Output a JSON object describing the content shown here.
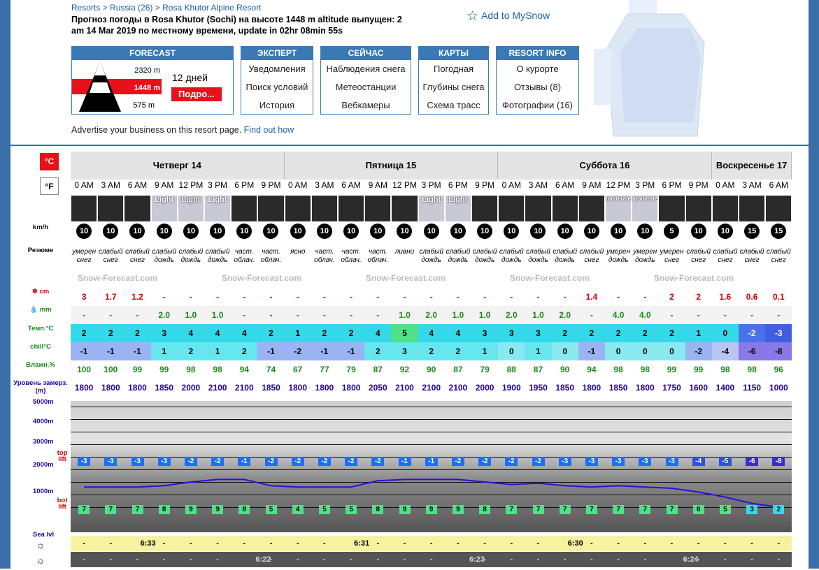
{
  "breadcrumb": {
    "resorts": "Resorts",
    "sep1": ">",
    "country": "Russia (26)",
    "sep2": ">",
    "resort": "Rosa Khutor Alpine Resort"
  },
  "headline": "Прогноз погоды в Rosa Khutor (Sochi) на высоте 1448 m altitude выпущен: 2 am  14 Mar 2019 по местному времени, update in 02hr 08min 55s",
  "mysnow": "Add to MySnow",
  "forecast_box": {
    "header": "FORECAST",
    "top": "2320 m",
    "mid": "1448 m",
    "bot": "575 m",
    "days": "12 дней",
    "button": "Подро..."
  },
  "menus": [
    {
      "header": "ЭКСПЕРТ",
      "items": [
        "Уведомления",
        "Поиск условий",
        "История"
      ]
    },
    {
      "header": "СЕЙЧАС",
      "items": [
        "Наблюдения снега",
        "Метеостанции",
        "Вебкамеры"
      ]
    },
    {
      "header": "КАРТЫ",
      "items": [
        "Погодная",
        "Глубины снега",
        "Схема трасс"
      ]
    },
    {
      "header": "RESORT INFO",
      "items": [
        "О курорте",
        "Отзывы (8)",
        "Фотографии (16)"
      ]
    }
  ],
  "advert": {
    "text": "Advertise your business on this resort page.",
    "link": "Find out how"
  },
  "units": {
    "c": "°C",
    "f": "°F"
  },
  "labels": {
    "wind": "km/h",
    "summary": "Резюме",
    "snow": "cm",
    "rain": "mm",
    "temp": "Темп.°C",
    "chill": "chill°C",
    "humid": "Влажн.%",
    "freeze": "Уровень замерз. (m)",
    "y5000": "5000m",
    "y4000": "4000m",
    "y3000": "3000m",
    "y2000": "2000m",
    "y1000": "1000m",
    "toplift": "top lift",
    "botlift": "bot lift",
    "sealvl": "Sea lvl"
  },
  "watermark": "Snow-Forecast.com",
  "days": [
    {
      "name": "Четверг 14",
      "cols": 8
    },
    {
      "name": "Пятница 15",
      "cols": 8
    },
    {
      "name": "Суббота 16",
      "cols": 8
    },
    {
      "name": "Воскресенье 17",
      "cols": 3
    }
  ],
  "hours": [
    "0 AM",
    "3 AM",
    "6 AM",
    "9 AM",
    "12 PM",
    "3 PM",
    "6 PM",
    "9 PM",
    "0 AM",
    "3 AM",
    "6 AM",
    "9 AM",
    "12 PM",
    "3 PM",
    "6 PM",
    "9 PM",
    "0 AM",
    "3 AM",
    "6 AM",
    "9 AM",
    "12 PM",
    "3 PM",
    "6 PM",
    "9 PM",
    "0 AM",
    "3 AM",
    "6 AM"
  ],
  "weather_text": [
    "",
    "",
    "",
    "Light",
    "Light",
    "Light",
    "",
    "",
    "",
    "",
    "",
    "",
    "",
    "Light",
    "Light",
    "",
    "",
    "",
    "",
    "",
    "moderate",
    "moderate",
    "",
    "",
    "",
    "",
    ""
  ],
  "wind": [
    "10",
    "10",
    "10",
    "10",
    "10",
    "10",
    "10",
    "10",
    "10",
    "10",
    "10",
    "10",
    "10",
    "10",
    "10",
    "10",
    "10",
    "10",
    "10",
    "10",
    "10",
    "10",
    "5",
    "10",
    "10",
    "15",
    "15"
  ],
  "summary": [
    "умерен снег",
    "слабый снег",
    "слабый снег",
    "слабый дождь",
    "слабый дождь",
    "слабый дождь",
    "част. облач.",
    "част. облач.",
    "ясно",
    "част. облач.",
    "част. облач.",
    "част. облач.",
    "ливни",
    "слабый дождь",
    "слабый дождь",
    "слабый дождь",
    "слабый дождь",
    "слабый дождь",
    "слабый дождь",
    "слабый снег",
    "умерен дождь",
    "умерен дождь",
    "умерен снег",
    "слабый снег",
    "слабый снег",
    "слабый снег",
    "слабый снег"
  ],
  "snow": [
    "3",
    "1.7",
    "1.2",
    "-",
    "-",
    "-",
    "-",
    "-",
    "-",
    "-",
    "-",
    "-",
    "-",
    "-",
    "-",
    "-",
    "-",
    "-",
    "-",
    "1.4",
    "-",
    "-",
    "2",
    "2",
    "1.6",
    "0.6",
    "0.1"
  ],
  "rain": [
    "-",
    "-",
    "-",
    "2.0",
    "1.0",
    "1.0",
    "-",
    "-",
    "-",
    "-",
    "-",
    "-",
    "1.0",
    "2.0",
    "1.0",
    "1.0",
    "2.0",
    "1.0",
    "2.0",
    "-",
    "4.0",
    "4.0",
    "-",
    "-",
    "-",
    "-",
    "-"
  ],
  "temp": [
    "2",
    "2",
    "2",
    "3",
    "4",
    "4",
    "4",
    "2",
    "1",
    "2",
    "2",
    "4",
    "5",
    "4",
    "4",
    "3",
    "3",
    "3",
    "2",
    "2",
    "2",
    "2",
    "2",
    "1",
    "0",
    "-2",
    "-3"
  ],
  "chill": [
    "-1",
    "-1",
    "-1",
    "1",
    "2",
    "1",
    "2",
    "-1",
    "-2",
    "-1",
    "-1",
    "2",
    "3",
    "2",
    "2",
    "1",
    "0",
    "1",
    "0",
    "-1",
    "0",
    "0",
    "0",
    "-2",
    "-4",
    "-6",
    "-8"
  ],
  "humid": [
    "100",
    "100",
    "99",
    "99",
    "98",
    "98",
    "94",
    "74",
    "67",
    "77",
    "79",
    "87",
    "92",
    "90",
    "87",
    "79",
    "88",
    "87",
    "90",
    "94",
    "98",
    "98",
    "99",
    "99",
    "98",
    "98",
    "96"
  ],
  "freeze": [
    "1800",
    "1800",
    "1800",
    "1850",
    "2000",
    "2100",
    "2100",
    "1850",
    "1800",
    "1800",
    "1800",
    "2050",
    "2100",
    "2100",
    "2100",
    "2000",
    "1900",
    "1950",
    "1850",
    "1800",
    "1850",
    "1800",
    "1750",
    "1600",
    "1400",
    "1150",
    "1000"
  ],
  "top_temp": [
    "-3",
    "-3",
    "-3",
    "-3",
    "-2",
    "-2",
    "-1",
    "-2",
    "-2",
    "-2",
    "-2",
    "-2",
    "-1",
    "-1",
    "-2",
    "-2",
    "-2",
    "-2",
    "-3",
    "-3",
    "-3",
    "-3",
    "-3",
    "-4",
    "-5",
    "-6",
    "-8"
  ],
  "bot_temp": [
    "7",
    "7",
    "7",
    "8",
    "9",
    "9",
    "8",
    "5",
    "4",
    "5",
    "5",
    "8",
    "9",
    "9",
    "9",
    "8",
    "7",
    "7",
    "7",
    "7",
    "7",
    "7",
    "7",
    "6",
    "5",
    "3",
    "2"
  ],
  "sunrise": [
    "-",
    "-",
    "6:33",
    "-",
    "-",
    "-",
    "-",
    "-",
    "-",
    "-",
    "6:31",
    "-",
    "-",
    "-",
    "-",
    "-",
    "-",
    "-",
    "6:30",
    "-",
    "-",
    "-",
    "-",
    "-",
    "-",
    "-",
    "-"
  ],
  "sunset": [
    "-",
    "-",
    "-",
    "-",
    "-",
    "-",
    "6:22",
    "-",
    "-",
    "-",
    "-",
    "-",
    "-",
    "-",
    "6:23",
    "-",
    "-",
    "-",
    "-",
    "-",
    "-",
    "-",
    "6:24",
    "-",
    "-",
    "-",
    "-"
  ]
}
